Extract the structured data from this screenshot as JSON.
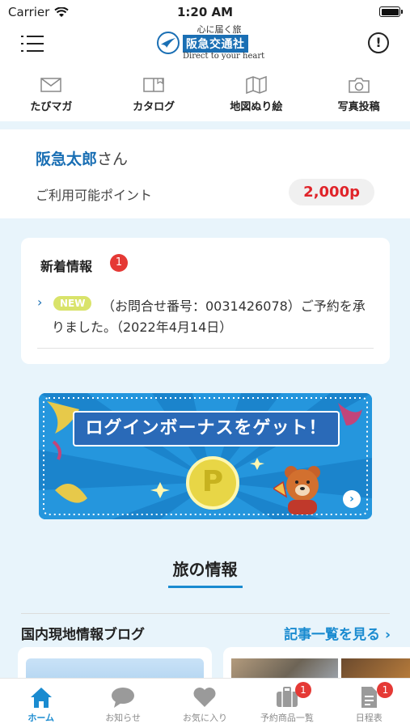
{
  "status": {
    "carrier": "Carrier",
    "time": "1:20 AM"
  },
  "header": {
    "logo_tagline": "心に届く旅",
    "logo_name": "阪急交通社",
    "logo_subtitle": "Direct to your heart"
  },
  "shortcuts": [
    {
      "label": "たびマガ",
      "icon": "mail-icon"
    },
    {
      "label": "カタログ",
      "icon": "catalog-icon"
    },
    {
      "label": "地図ぬり絵",
      "icon": "map-icon"
    },
    {
      "label": "写真投稿",
      "icon": "camera-icon"
    }
  ],
  "user": {
    "name": "阪急太郎",
    "suffix": "さん",
    "points_label": "ご利用可能ポイント",
    "points_value": "2,000p"
  },
  "news": {
    "title": "新着情報",
    "count": "1",
    "badge": "NEW",
    "text": "（お問合せ番号：0031426078）ご予約を承りました。（2022年4月14日）"
  },
  "banner": {
    "headline": "ログインボーナスをゲット！",
    "coin_letter": "P"
  },
  "section": {
    "title": "旅の情報",
    "blog_heading": "国内現地情報ブログ",
    "blog_link": "記事一覧を見る ›"
  },
  "tabbar": [
    {
      "label": "ホーム",
      "icon": "home-icon",
      "active": true
    },
    {
      "label": "お知らせ",
      "icon": "chat-icon"
    },
    {
      "label": "お気に入り",
      "icon": "heart-icon"
    },
    {
      "label": "予約商品一覧",
      "icon": "suitcase-icon",
      "badge": "1"
    },
    {
      "label": "日程表",
      "icon": "document-icon",
      "badge": "1"
    }
  ],
  "colors": {
    "brand": "#1a6fb4",
    "accent": "#1a8bd0",
    "alert": "#e53935",
    "points": "#e0242a"
  }
}
